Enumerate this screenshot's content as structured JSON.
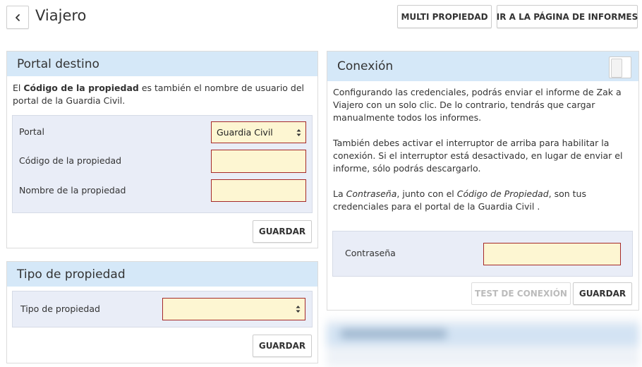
{
  "header": {
    "title": "Viajero",
    "multi_label": "MULTI PROPIEDAD",
    "informes_label": "IR A LA PÁGINA DE INFORMES"
  },
  "portal_destino": {
    "title": "Portal destino",
    "desc_pre": "El ",
    "desc_bold": "Código de la propiedad",
    "desc_post": " es también el nombre de usuario del portal de la Guardia Civil.",
    "portal_label": "Portal",
    "portal_value": "Guardia Civil",
    "codigo_label": "Código de la propiedad",
    "codigo_value": "",
    "nombre_label": "Nombre de la propiedad",
    "nombre_value": "",
    "save_label": "GUARDAR"
  },
  "tipo_propiedad": {
    "title": "Tipo de propiedad",
    "tipo_label": "Tipo de propiedad",
    "tipo_value": "",
    "save_label": "GUARDAR"
  },
  "conexion": {
    "title": "Conexión",
    "p1": "Configurando las credenciales, podrás enviar el informe de Zak a Viajero con un solo clic. De lo contrario, tendrás que cargar manualmente todos los informes.",
    "p2": "También debes activar el interruptor de arriba para habilitar la conexión. Si el interruptor está desactivado, en lugar de enviar el informe, sólo podrás descargarlo.",
    "p3_a": "La ",
    "p3_em1": "Contraseña",
    "p3_b": ", junto con el ",
    "p3_em2": "Código de Propiedad",
    "p3_c": ", son tus credenciales para el portal de la Guardia Civil .",
    "password_label": "Contraseña",
    "password_value": "",
    "test_label": "TEST DE CONEXIÓN",
    "save_label": "GUARDAR"
  }
}
